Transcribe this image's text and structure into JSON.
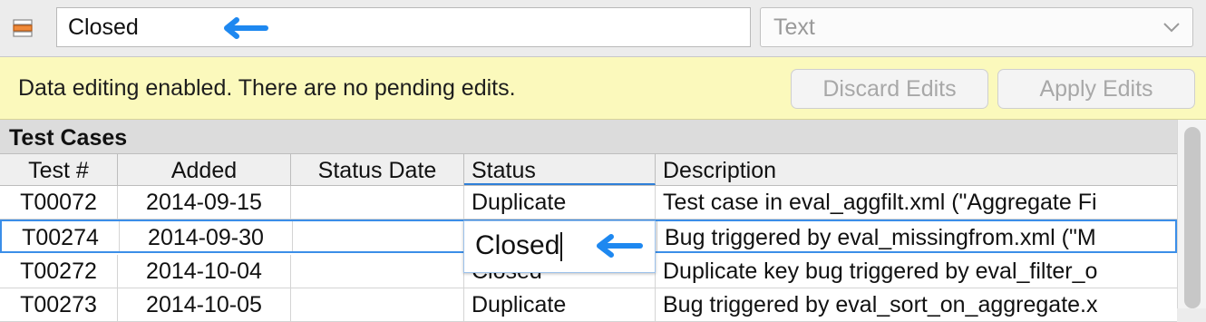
{
  "toolbar": {
    "value": "Closed",
    "type_selected": "Text",
    "icons": {
      "row": "table-row-icon",
      "arrow": "blue-arrow-left-icon",
      "chevron": "chevron-down-icon"
    }
  },
  "infobar": {
    "message": "Data editing enabled. There are no pending edits.",
    "discard_label": "Discard Edits",
    "apply_label": "Apply Edits"
  },
  "table": {
    "title": "Test Cases",
    "columns": [
      "Test #",
      "Added",
      "Status Date",
      "Status",
      "Description"
    ],
    "rows": [
      [
        "T00072",
        "2014-09-15",
        "",
        "Duplicate",
        "Test case in eval_aggfilt.xml (\"Aggregate Fi"
      ],
      [
        "T00274",
        "2014-09-30",
        "",
        "",
        "Bug triggered by eval_missingfrom.xml (\"M"
      ],
      [
        "T00272",
        "2014-10-04",
        "",
        "Closed",
        "Duplicate key bug triggered by eval_filter_o"
      ],
      [
        "T00273",
        "2014-10-05",
        "",
        "Duplicate",
        "Bug triggered by eval_sort_on_aggregate.x"
      ]
    ],
    "editor_value": "Closed"
  },
  "colors": {
    "accent": "#2f7fd8",
    "info_bar": "#fbf9bc"
  }
}
